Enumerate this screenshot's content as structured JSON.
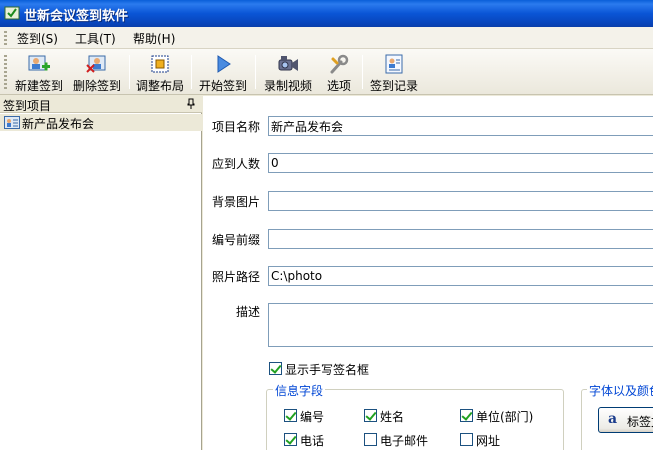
{
  "window": {
    "title": "世新会议签到软件"
  },
  "menu": {
    "items": [
      {
        "label": "签到(S)"
      },
      {
        "label": "工具(T)"
      },
      {
        "label": "帮助(H)"
      }
    ]
  },
  "toolbar": {
    "buttons": [
      {
        "label": "新建签到",
        "icon": "new-checkin-icon"
      },
      {
        "label": "删除签到",
        "icon": "delete-checkin-icon"
      },
      {
        "label": "调整布局",
        "icon": "layout-icon"
      },
      {
        "label": "开始签到",
        "icon": "play-icon"
      },
      {
        "label": "录制视频",
        "icon": "camera-icon"
      },
      {
        "label": "选项",
        "icon": "wrench-icon"
      },
      {
        "label": "签到记录",
        "icon": "records-icon"
      }
    ]
  },
  "left_panel": {
    "header": "签到项目",
    "items": [
      {
        "label": "新产品发布会"
      }
    ]
  },
  "form": {
    "project_name": {
      "label": "项目名称",
      "value": "新产品发布会"
    },
    "expected_count": {
      "label": "应到人数",
      "value": "0"
    },
    "background_image": {
      "label": "背景图片",
      "value": ""
    },
    "number_prefix": {
      "label": "编号前缀",
      "value": ""
    },
    "photo_path": {
      "label": "照片路径",
      "value": "C:\\photo"
    },
    "description": {
      "label": "描述",
      "value": ""
    },
    "show_signature": {
      "label": "显示手写签名框",
      "checked": true
    },
    "info_fields": {
      "title": "信息字段",
      "fields": [
        {
          "label": "编号",
          "checked": true
        },
        {
          "label": "姓名",
          "checked": true
        },
        {
          "label": "单位(部门)",
          "checked": true
        },
        {
          "label": "电话",
          "checked": true
        },
        {
          "label": "电子邮件",
          "checked": false
        },
        {
          "label": "网址",
          "checked": false
        }
      ]
    },
    "font_color": {
      "title": "字体以及颜色",
      "button_label": "标签文字"
    }
  },
  "colors": {
    "title_bar": "#0a55d6",
    "group_title": "#0046d5",
    "check_mark": "#21a121"
  }
}
